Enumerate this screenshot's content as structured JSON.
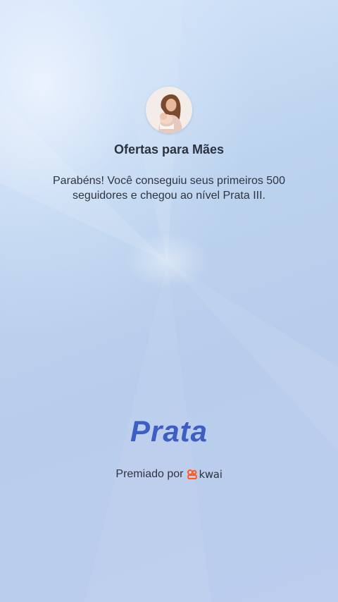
{
  "profile": {
    "name": "Ofertas para Mães",
    "avatar": "profile-photo-mother-with-baby"
  },
  "message": "Parabéns! Você conseguiu seus primeiros 500 seguidores e chegou ao nível Prata III.",
  "level": {
    "name": "Prata",
    "color": "#3d5fc4"
  },
  "awarded_by": {
    "label": "Premiado por",
    "brand": "kwai",
    "brand_color": "#ff5a1f"
  }
}
